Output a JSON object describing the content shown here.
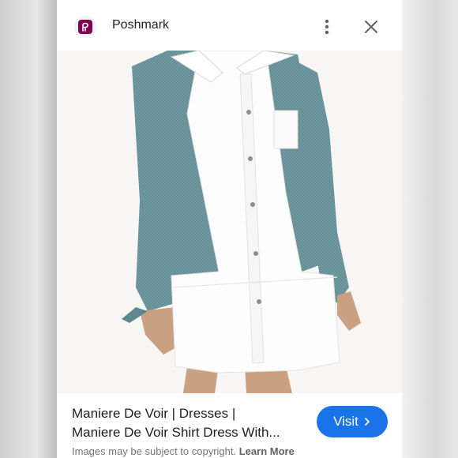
{
  "header": {
    "app_name": "Poshmark",
    "logo_icon": "poshmark-logo-icon",
    "menu_icon": "more-vert-icon",
    "close_icon": "close-icon"
  },
  "image": {
    "description_icon": "product-photo"
  },
  "footer": {
    "title_line1": "Maniere De Voir | Dresses |",
    "title_line2": "Maniere De Voir Shirt Dress With...",
    "visit_label": "Visit",
    "copyright_text": "Images may be subject to copyright.",
    "learn_more_label": "Learn More"
  },
  "colors": {
    "accent": "#1a73e8",
    "brand": "#7f0353"
  }
}
